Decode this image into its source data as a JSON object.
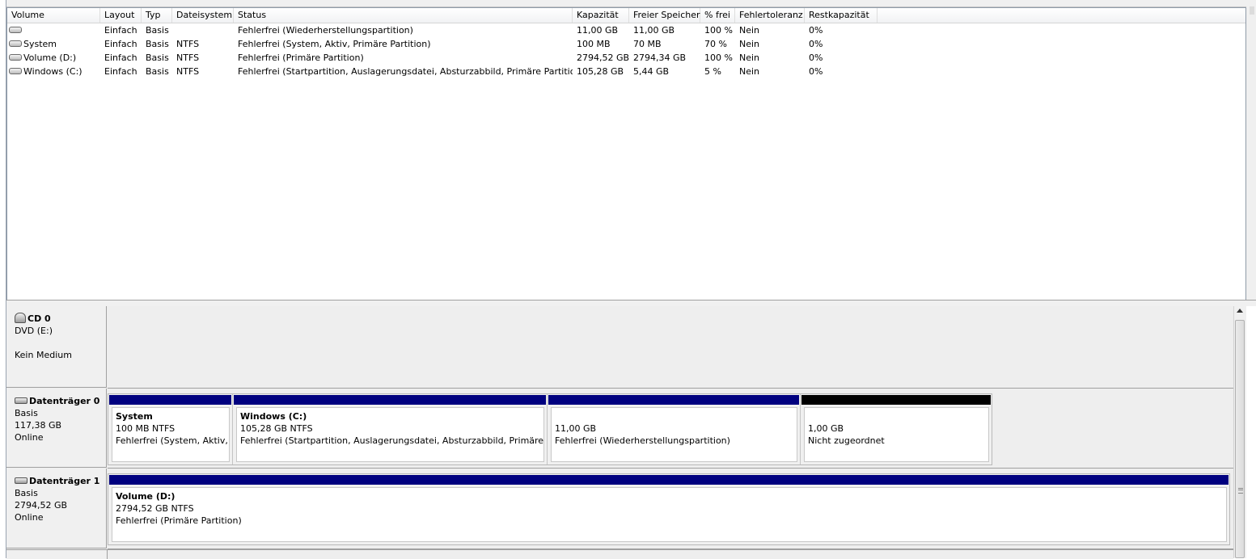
{
  "volume_list": {
    "columns": [
      "Volume",
      "Layout",
      "Typ",
      "Dateisystem",
      "Status",
      "Kapazität",
      "Freier Speicher",
      "% frei",
      "Fehlertoleranz",
      "Restkapazität"
    ],
    "rows": [
      {
        "volume": "",
        "layout": "Einfach",
        "typ": "Basis",
        "fs": "",
        "status": "Fehlerfrei (Wiederherstellungspartition)",
        "kapazitaet": "11,00 GB",
        "frei": "11,00 GB",
        "prozent": "100 %",
        "fehlertoleranz": "Nein",
        "rest": "0%"
      },
      {
        "volume": "System",
        "layout": "Einfach",
        "typ": "Basis",
        "fs": "NTFS",
        "status": "Fehlerfrei (System, Aktiv, Primäre Partition)",
        "kapazitaet": "100 MB",
        "frei": "70 MB",
        "prozent": "70 %",
        "fehlertoleranz": "Nein",
        "rest": "0%"
      },
      {
        "volume": "Volume (D:)",
        "layout": "Einfach",
        "typ": "Basis",
        "fs": "NTFS",
        "status": "Fehlerfrei (Primäre Partition)",
        "kapazitaet": "2794,52 GB",
        "frei": "2794,34 GB",
        "prozent": "100 %",
        "fehlertoleranz": "Nein",
        "rest": "0%"
      },
      {
        "volume": "Windows (C:)",
        "layout": "Einfach",
        "typ": "Basis",
        "fs": "NTFS",
        "status": "Fehlerfrei (Startpartition, Auslagerungsdatei, Absturzabbild, Primäre Partition)",
        "kapazitaet": "105,28 GB",
        "frei": "5,44 GB",
        "prozent": "5 %",
        "fehlertoleranz": "Nein",
        "rest": "0%"
      }
    ]
  },
  "disks": {
    "cd0": {
      "name": "CD 0",
      "line1": "DVD (E:)",
      "line2": "Kein Medium"
    },
    "disk0": {
      "name": "Datenträger 0",
      "type": "Basis",
      "size": "117,38 GB",
      "state": "Online",
      "partitions": [
        {
          "title": "System",
          "size": "100 MB NTFS",
          "status": "Fehlerfrei (System, Aktiv, Primäre Partition)"
        },
        {
          "title": "Windows  (C:)",
          "size": "105,28 GB NTFS",
          "status": "Fehlerfrei (Startpartition, Auslagerungsdatei, Absturzabbild, Primäre Partition)"
        },
        {
          "title": "",
          "size": "11,00 GB",
          "status": "Fehlerfrei (Wiederherstellungspartition)"
        },
        {
          "title": "",
          "size": "1,00 GB",
          "status": "Nicht zugeordnet"
        }
      ]
    },
    "disk1": {
      "name": "Datenträger 1",
      "type": "Basis",
      "size": "2794,52 GB",
      "state": "Online",
      "partitions": [
        {
          "title": "Volume  (D:)",
          "size": "2794,52 GB NTFS",
          "status": "Fehlerfrei (Primäre Partition)"
        }
      ]
    }
  },
  "colors": {
    "primary_partition_bar": "#00007f",
    "unallocated_bar": "#000000",
    "accent_border": "#8e9aa8"
  },
  "icons": {
    "volume": "drive-icon",
    "cd": "cd-drive-icon",
    "disk": "hard-disk-icon"
  }
}
